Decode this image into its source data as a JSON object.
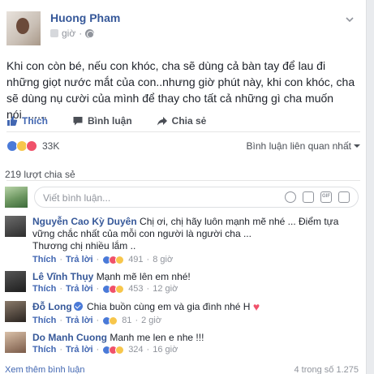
{
  "post": {
    "author": "Huong Pham",
    "time": "giờ",
    "text": "Khi con còn bé, nếu con khóc, cha sẽ dùng cả bàn tay để lau đi những giọt nước mắt của con..nhưng giờ phút này, khi con khóc, cha sẽ dùng nụ cười của mình để thay cho tất cả những gì cha muốn nói........"
  },
  "actions": {
    "like": "Thích",
    "comment": "Bình luận",
    "share": "Chia sẻ"
  },
  "reactions": {
    "count": "33K",
    "filter": "Bình luận liên quan nhất"
  },
  "shares": "219 lượt chia sẻ",
  "composer": {
    "placeholder": "Viết bình luận...",
    "gif": "GIF"
  },
  "comments": [
    {
      "name": "Nguyễn Cao Kỳ Duyên",
      "text": "Chị ơi, chị hãy luôn mạnh mẽ nhé ... Điểm tựa vững chắc nhất của mỗi con người là người cha ...",
      "text2": "Thương chị nhiều lắm ..",
      "like": "Thích",
      "reply": "Trả lời",
      "count": "491",
      "time": "8 giờ"
    },
    {
      "name": "Lê Vĩnh Thụy",
      "text": "Mạnh mẽ lên em nhé!",
      "like": "Thích",
      "reply": "Trả lời",
      "count": "453",
      "time": "12 giờ"
    },
    {
      "name": "Đỗ Long",
      "text": "Chia buồn cùng em và gia đình nhé H",
      "like": "Thích",
      "reply": "Trả lời",
      "count": "81",
      "time": "2 giờ"
    },
    {
      "name": "Do Manh Cuong",
      "text": "Manh me len e nhe !!!",
      "like": "Thích",
      "reply": "Trả lời",
      "count": "324",
      "time": "16 giờ"
    }
  ],
  "footer": {
    "more": "Xem thêm bình luận",
    "pagination": "4 trong số 1.275"
  }
}
